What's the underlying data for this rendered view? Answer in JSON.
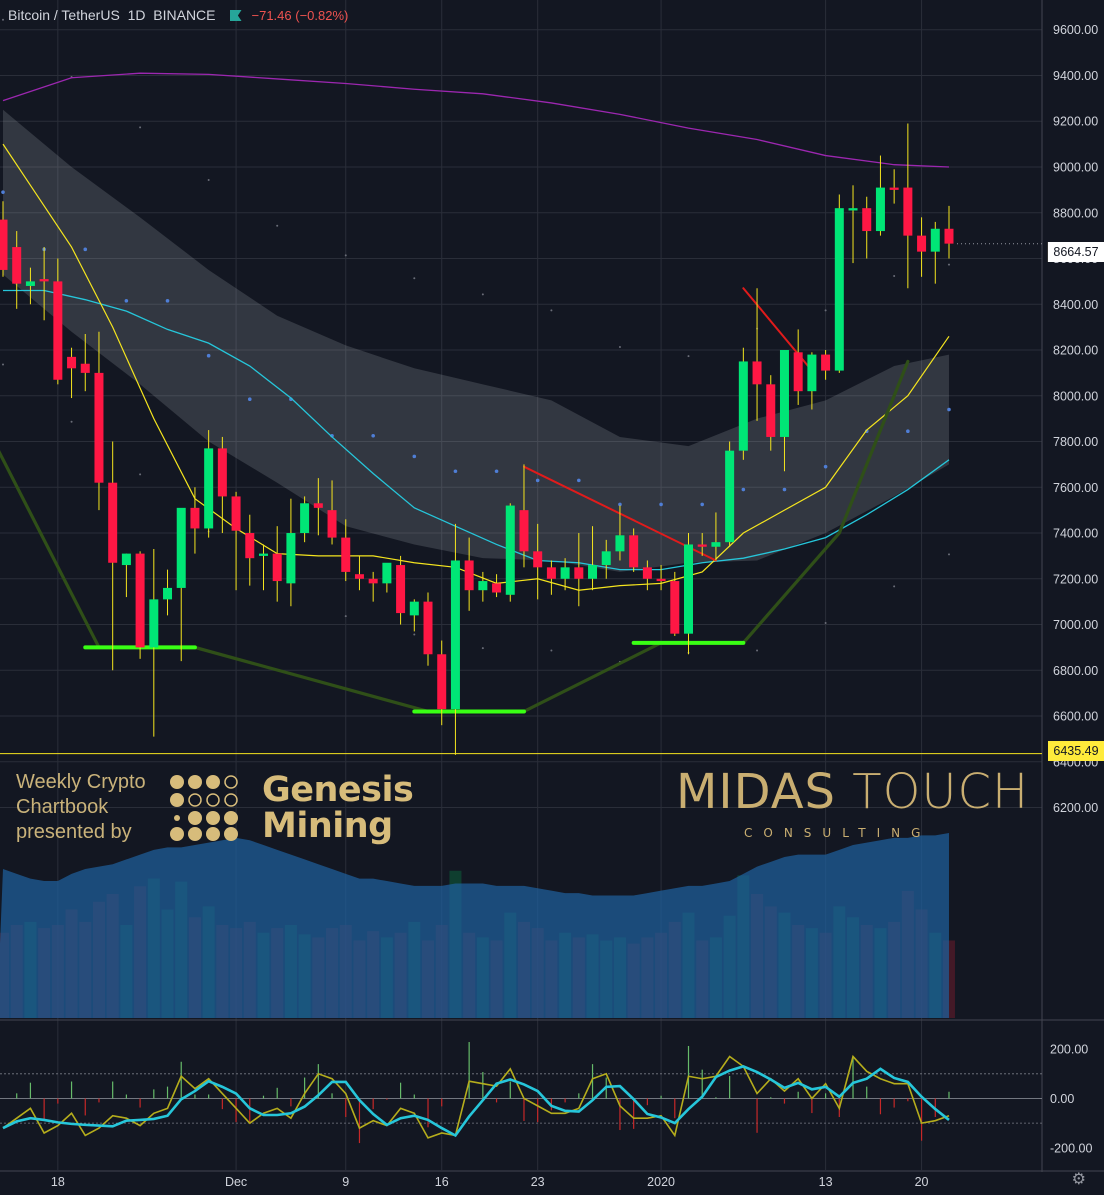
{
  "header": {
    "symbol": "Bitcoin / TetherUS",
    "interval": "1D",
    "exchange": "BINANCE",
    "change": "−71.46 (−0.82%)"
  },
  "badges": {
    "last_price": "8664.57",
    "low_line": "6435.49"
  },
  "watermark": {
    "left_lines": [
      "Weekly Crypto",
      "Chartbook",
      "presented by"
    ],
    "brand_lines": [
      "Genesis",
      "Mining"
    ],
    "midas_a": "MIDAS",
    "midas_b": "TOUCH",
    "midas_sub": "CONSULTING"
  },
  "colors": {
    "background": "#131722",
    "up": "#00e676",
    "down": "#ff1744",
    "sma_yellow": "#f5e51e",
    "sma_cyan": "#26c6da",
    "sma_purple": "#9c27b0",
    "band_fill": "#d1d4dc",
    "volume_ma": "#1e5f9c",
    "pattern_green": "#2e4a1a",
    "macd_yellow": "#b5ad1c",
    "macd_cyan": "#26c6da"
  },
  "chart_data": [
    {
      "type": "candlestick",
      "title": "Bitcoin / TetherUS 1D BINANCE",
      "y_axis": {
        "ticks": [
          6200,
          6400,
          6600,
          6800,
          7000,
          7200,
          7400,
          7600,
          7800,
          8000,
          8200,
          8400,
          8600,
          8800,
          9000,
          9200,
          9400,
          9600
        ],
        "ylim": [
          5280,
          9730
        ]
      },
      "x_axis": {
        "ticks": [
          "18",
          "Dec",
          "9",
          "16",
          "23",
          "2020",
          "13",
          "20"
        ],
        "tick_days": [
          4,
          17,
          25,
          32,
          39,
          48,
          60,
          67
        ]
      },
      "candles": [
        {
          "d": 0,
          "o": 8770,
          "h": 8850,
          "l": 8520,
          "c": 8550
        },
        {
          "d": 1,
          "o": 8650,
          "h": 8720,
          "l": 8380,
          "c": 8490
        },
        {
          "d": 2,
          "o": 8480,
          "h": 8560,
          "l": 8400,
          "c": 8500
        },
        {
          "d": 3,
          "o": 8510,
          "h": 8650,
          "l": 8330,
          "c": 8500
        },
        {
          "d": 4,
          "o": 8500,
          "h": 8600,
          "l": 8050,
          "c": 8070
        },
        {
          "d": 5,
          "o": 8170,
          "h": 8210,
          "l": 7990,
          "c": 8120
        },
        {
          "d": 6,
          "o": 8140,
          "h": 8270,
          "l": 8020,
          "c": 8100
        },
        {
          "d": 7,
          "o": 8100,
          "h": 8280,
          "l": 7500,
          "c": 7620
        },
        {
          "d": 8,
          "o": 7620,
          "h": 7800,
          "l": 6800,
          "c": 7270
        },
        {
          "d": 9,
          "o": 7260,
          "h": 7310,
          "l": 7120,
          "c": 7310
        },
        {
          "d": 10,
          "o": 7310,
          "h": 7320,
          "l": 6850,
          "c": 6900
        },
        {
          "d": 11,
          "o": 6900,
          "h": 7330,
          "l": 6510,
          "c": 7110
        },
        {
          "d": 12,
          "o": 7110,
          "h": 7240,
          "l": 7040,
          "c": 7160
        },
        {
          "d": 13,
          "o": 7160,
          "h": 7450,
          "l": 6840,
          "c": 7510
        },
        {
          "d": 14,
          "o": 7510,
          "h": 7600,
          "l": 7310,
          "c": 7420
        },
        {
          "d": 15,
          "o": 7420,
          "h": 7850,
          "l": 7380,
          "c": 7770
        },
        {
          "d": 16,
          "o": 7770,
          "h": 7820,
          "l": 7400,
          "c": 7560
        },
        {
          "d": 17,
          "o": 7560,
          "h": 7580,
          "l": 7150,
          "c": 7410
        },
        {
          "d": 18,
          "o": 7400,
          "h": 7480,
          "l": 7170,
          "c": 7290
        },
        {
          "d": 19,
          "o": 7300,
          "h": 7350,
          "l": 7150,
          "c": 7310
        },
        {
          "d": 20,
          "o": 7310,
          "h": 7430,
          "l": 7100,
          "c": 7190
        },
        {
          "d": 21,
          "o": 7180,
          "h": 7550,
          "l": 7080,
          "c": 7400
        },
        {
          "d": 22,
          "o": 7400,
          "h": 7560,
          "l": 7360,
          "c": 7530
        },
        {
          "d": 23,
          "o": 7530,
          "h": 7640,
          "l": 7390,
          "c": 7510
        },
        {
          "d": 24,
          "o": 7500,
          "h": 7630,
          "l": 7350,
          "c": 7380
        },
        {
          "d": 25,
          "o": 7380,
          "h": 7460,
          "l": 7190,
          "c": 7230
        },
        {
          "d": 26,
          "o": 7220,
          "h": 7300,
          "l": 7150,
          "c": 7200
        },
        {
          "d": 27,
          "o": 7200,
          "h": 7230,
          "l": 7100,
          "c": 7180
        },
        {
          "d": 28,
          "o": 7180,
          "h": 7250,
          "l": 7140,
          "c": 7270
        },
        {
          "d": 29,
          "o": 7260,
          "h": 7300,
          "l": 7000,
          "c": 7050
        },
        {
          "d": 30,
          "o": 7040,
          "h": 7110,
          "l": 6970,
          "c": 7100
        },
        {
          "d": 31,
          "o": 7100,
          "h": 7140,
          "l": 6820,
          "c": 6870
        },
        {
          "d": 32,
          "o": 6870,
          "h": 6930,
          "l": 6560,
          "c": 6630
        },
        {
          "d": 33,
          "o": 6630,
          "h": 7440,
          "l": 6430,
          "c": 7280
        },
        {
          "d": 34,
          "o": 7280,
          "h": 7380,
          "l": 7060,
          "c": 7150
        },
        {
          "d": 35,
          "o": 7150,
          "h": 7230,
          "l": 7100,
          "c": 7190
        },
        {
          "d": 36,
          "o": 7180,
          "h": 7220,
          "l": 7120,
          "c": 7140
        },
        {
          "d": 37,
          "o": 7130,
          "h": 7530,
          "l": 7100,
          "c": 7520
        },
        {
          "d": 38,
          "o": 7500,
          "h": 7700,
          "l": 7250,
          "c": 7320
        },
        {
          "d": 39,
          "o": 7320,
          "h": 7440,
          "l": 7110,
          "c": 7250
        },
        {
          "d": 40,
          "o": 7250,
          "h": 7280,
          "l": 7130,
          "c": 7200
        },
        {
          "d": 41,
          "o": 7200,
          "h": 7290,
          "l": 7150,
          "c": 7250
        },
        {
          "d": 42,
          "o": 7250,
          "h": 7400,
          "l": 7080,
          "c": 7200
        },
        {
          "d": 43,
          "o": 7200,
          "h": 7430,
          "l": 7150,
          "c": 7260
        },
        {
          "d": 44,
          "o": 7260,
          "h": 7370,
          "l": 7200,
          "c": 7320
        },
        {
          "d": 45,
          "o": 7320,
          "h": 7520,
          "l": 7280,
          "c": 7390
        },
        {
          "d": 46,
          "o": 7390,
          "h": 7420,
          "l": 7230,
          "c": 7250
        },
        {
          "d": 47,
          "o": 7250,
          "h": 7280,
          "l": 7150,
          "c": 7200
        },
        {
          "d": 48,
          "o": 7200,
          "h": 7260,
          "l": 7150,
          "c": 7190
        },
        {
          "d": 49,
          "o": 7190,
          "h": 7230,
          "l": 6950,
          "c": 6960
        },
        {
          "d": 50,
          "o": 6960,
          "h": 7400,
          "l": 6870,
          "c": 7350
        },
        {
          "d": 51,
          "o": 7350,
          "h": 7400,
          "l": 7300,
          "c": 7340
        },
        {
          "d": 52,
          "o": 7340,
          "h": 7490,
          "l": 7280,
          "c": 7360
        },
        {
          "d": 53,
          "o": 7360,
          "h": 7800,
          "l": 7340,
          "c": 7760
        },
        {
          "d": 54,
          "o": 7760,
          "h": 8210,
          "l": 7720,
          "c": 8150
        },
        {
          "d": 55,
          "o": 8150,
          "h": 8470,
          "l": 7890,
          "c": 8050
        },
        {
          "d": 56,
          "o": 8050,
          "h": 8090,
          "l": 7760,
          "c": 7820
        },
        {
          "d": 57,
          "o": 7820,
          "h": 8200,
          "l": 7670,
          "c": 8200
        },
        {
          "d": 58,
          "o": 8190,
          "h": 8290,
          "l": 7960,
          "c": 8020
        },
        {
          "d": 59,
          "o": 8020,
          "h": 8190,
          "l": 7940,
          "c": 8180
        },
        {
          "d": 60,
          "o": 8180,
          "h": 8200,
          "l": 8070,
          "c": 8110
        },
        {
          "d": 61,
          "o": 8110,
          "h": 8880,
          "l": 8100,
          "c": 8820
        },
        {
          "d": 62,
          "o": 8810,
          "h": 8920,
          "l": 8580,
          "c": 8820
        },
        {
          "d": 63,
          "o": 8820,
          "h": 8870,
          "l": 8600,
          "c": 8720
        },
        {
          "d": 64,
          "o": 8720,
          "h": 9050,
          "l": 8700,
          "c": 8910
        },
        {
          "d": 65,
          "o": 8910,
          "h": 8990,
          "l": 8840,
          "c": 8900
        },
        {
          "d": 66,
          "o": 8910,
          "h": 9190,
          "l": 8470,
          "c": 8700
        },
        {
          "d": 67,
          "o": 8700,
          "h": 8780,
          "l": 8520,
          "c": 8630
        },
        {
          "d": 68,
          "o": 8630,
          "h": 8760,
          "l": 8490,
          "c": 8730
        },
        {
          "d": 69,
          "o": 8730,
          "h": 8830,
          "l": 8600,
          "c": 8665
        }
      ],
      "sma_yellow": [
        [
          0,
          9100
        ],
        [
          2,
          8920
        ],
        [
          5,
          8650
        ],
        [
          8,
          8300
        ],
        [
          11,
          7900
        ],
        [
          14,
          7550
        ],
        [
          17,
          7420
        ],
        [
          20,
          7310
        ],
        [
          23,
          7300
        ],
        [
          27,
          7300
        ],
        [
          30,
          7270
        ],
        [
          33,
          7250
        ],
        [
          36,
          7180
        ],
        [
          39,
          7200
        ],
        [
          42,
          7150
        ],
        [
          45,
          7170
        ],
        [
          48,
          7180
        ],
        [
          51,
          7230
        ],
        [
          54,
          7400
        ],
        [
          57,
          7500
        ],
        [
          60,
          7600
        ],
        [
          63,
          7850
        ],
        [
          66,
          8000
        ],
        [
          69,
          8260
        ]
      ],
      "sma_cyan": [
        [
          0,
          8460
        ],
        [
          3,
          8460
        ],
        [
          6,
          8420
        ],
        [
          9,
          8370
        ],
        [
          12,
          8290
        ],
        [
          15,
          8230
        ],
        [
          18,
          8130
        ],
        [
          21,
          7990
        ],
        [
          24,
          7820
        ],
        [
          27,
          7660
        ],
        [
          30,
          7510
        ],
        [
          33,
          7430
        ],
        [
          36,
          7350
        ],
        [
          39,
          7280
        ],
        [
          42,
          7270
        ],
        [
          45,
          7240
        ],
        [
          48,
          7240
        ],
        [
          51,
          7270
        ],
        [
          54,
          7290
        ],
        [
          57,
          7330
        ],
        [
          60,
          7380
        ],
        [
          63,
          7480
        ],
        [
          66,
          7590
        ],
        [
          69,
          7720
        ]
      ],
      "sma_purple": [
        [
          0,
          9290
        ],
        [
          5,
          9390
        ],
        [
          10,
          9410
        ],
        [
          15,
          9405
        ],
        [
          20,
          9385
        ],
        [
          25,
          9365
        ],
        [
          30,
          9340
        ],
        [
          35,
          9320
        ],
        [
          40,
          9280
        ],
        [
          45,
          9230
        ],
        [
          50,
          9170
        ],
        [
          55,
          9120
        ],
        [
          60,
          9050
        ],
        [
          65,
          9010
        ],
        [
          69,
          9000
        ]
      ],
      "band_upper": [
        [
          0,
          9250
        ],
        [
          5,
          9000
        ],
        [
          10,
          8780
        ],
        [
          15,
          8550
        ],
        [
          20,
          8350
        ],
        [
          25,
          8220
        ],
        [
          30,
          8120
        ],
        [
          35,
          8050
        ],
        [
          40,
          7980
        ],
        [
          45,
          7820
        ],
        [
          50,
          7780
        ],
        [
          55,
          7900
        ],
        [
          60,
          7980
        ],
        [
          65,
          8130
        ],
        [
          69,
          8180
        ]
      ],
      "band_lower": [
        [
          0,
          8530
        ],
        [
          5,
          8280
        ],
        [
          10,
          8050
        ],
        [
          15,
          7800
        ],
        [
          20,
          7620
        ],
        [
          25,
          7430
        ],
        [
          30,
          7350
        ],
        [
          35,
          7290
        ],
        [
          40,
          7280
        ],
        [
          45,
          7230
        ],
        [
          50,
          7270
        ],
        [
          55,
          7280
        ],
        [
          60,
          7400
        ],
        [
          65,
          7560
        ],
        [
          69,
          7700
        ]
      ],
      "pattern_lines": [
        {
          "color": "green_dark",
          "points": [
            [
              -0.5,
              7780
            ],
            [
              7,
              6900
            ],
            [
              14,
              6900
            ],
            [
              31,
              6620
            ],
            [
              38,
              6620
            ],
            [
              48,
              6920
            ],
            [
              54,
              6920
            ],
            [
              61,
              7400
            ],
            [
              66,
              8150
            ]
          ]
        },
        {
          "color": "green",
          "points": [
            [
              6,
              6900
            ],
            [
              14,
              6900
            ]
          ]
        },
        {
          "color": "green",
          "points": [
            [
              30,
              6620
            ],
            [
              38,
              6620
            ]
          ]
        },
        {
          "color": "green",
          "points": [
            [
              46,
              6920
            ],
            [
              54,
              6920
            ]
          ]
        },
        {
          "color": "red",
          "points": [
            [
              38,
              7690
            ],
            [
              52,
              7280
            ]
          ]
        },
        {
          "color": "red",
          "points": [
            [
              54,
              8470
            ],
            [
              59,
              8110
            ]
          ]
        }
      ],
      "support_line": 6435.49,
      "last_price": 8664.57
    },
    {
      "type": "bar",
      "title": "Volume",
      "volume": [
        55,
        60,
        62,
        58,
        60,
        70,
        62,
        75,
        80,
        60,
        85,
        90,
        70,
        88,
        65,
        72,
        60,
        58,
        62,
        55,
        58,
        60,
        54,
        52,
        58,
        60,
        50,
        56,
        52,
        55,
        62,
        50,
        60,
        95,
        55,
        52,
        50,
        68,
        62,
        58,
        50,
        55,
        52,
        54,
        50,
        52,
        48,
        52,
        55,
        62,
        68,
        50,
        52,
        66,
        92,
        80,
        72,
        68,
        60,
        58,
        55,
        72,
        65,
        60,
        58,
        62,
        82,
        70,
        55,
        50
      ],
      "volume_ma": [
        62,
        60,
        58,
        57,
        57,
        60,
        62,
        63,
        64,
        66,
        68,
        70,
        71,
        71,
        72,
        73,
        74,
        75,
        74,
        72,
        70,
        68,
        66,
        64,
        62,
        60,
        58,
        58,
        57,
        56,
        55,
        55,
        55,
        56,
        56,
        56,
        55,
        55,
        55,
        54,
        53,
        52,
        52,
        51,
        51,
        51,
        51,
        52,
        53,
        54,
        55,
        55,
        56,
        57,
        60,
        63,
        65,
        67,
        68,
        68,
        68,
        70,
        72,
        73,
        74,
        75,
        75,
        76,
        76,
        77
      ]
    },
    {
      "type": "line",
      "title": "Oscillator",
      "y_axis": {
        "ticks": [
          -200,
          0,
          200
        ],
        "ylim": [
          -290,
          310
        ],
        "dotted_levels": [
          100,
          -100
        ]
      },
      "yellow": [
        -120,
        -80,
        -40,
        -140,
        -110,
        -60,
        -150,
        -120,
        -70,
        -80,
        -110,
        -60,
        -40,
        90,
        40,
        80,
        20,
        -40,
        -100,
        -60,
        -40,
        -80,
        20,
        100,
        80,
        20,
        -120,
        -90,
        -110,
        -40,
        -60,
        -160,
        -140,
        -150,
        70,
        60,
        50,
        120,
        0,
        -30,
        -60,
        -60,
        -40,
        80,
        100,
        -30,
        -80,
        -80,
        -70,
        -150,
        90,
        80,
        90,
        170,
        130,
        20,
        80,
        30,
        80,
        0,
        60,
        -40,
        170,
        110,
        80,
        60,
        60,
        -100,
        -90,
        -70
      ]
    }
  ]
}
